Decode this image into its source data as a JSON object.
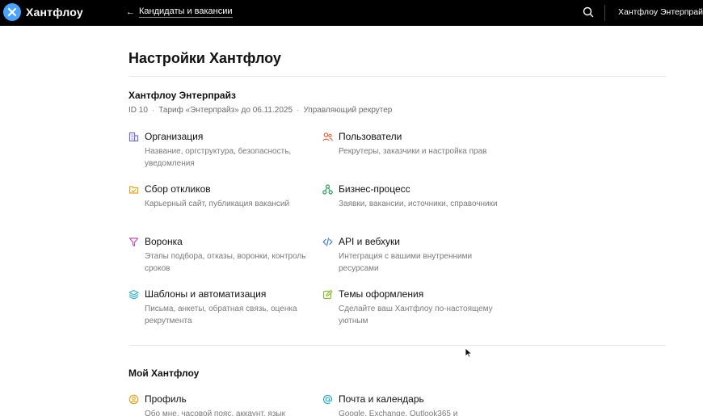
{
  "topbar": {
    "logo_text": "Хантфлоу",
    "back_label": "Кандидаты и вакансии",
    "org_name": "Хантфлоу Энтерпрайз"
  },
  "page": {
    "title": "Настройки Хантфлоу"
  },
  "company": {
    "name": "Хантфлоу Энтерпрайз",
    "id": "ID 10",
    "tariff": "Тариф «Энтерпрайз» до 06.11.2025",
    "role": "Управляющий рекрутер"
  },
  "settings": {
    "items": [
      {
        "title": "Организация",
        "desc": "Название, оргструктура, безопасность, уведомления",
        "icon": "building-icon",
        "color": "#6b6fd6"
      },
      {
        "title": "Пользователи",
        "desc": "Рекрутеры, заказчики и настройка прав",
        "icon": "users-icon",
        "color": "#e0653a"
      },
      {
        "title": "Сбор откликов",
        "desc": "Карьерный сайт, публикация вакансий",
        "icon": "folder-icon",
        "color": "#e6a31a"
      },
      {
        "title": "Бизнес-процесс",
        "desc": "Заявки, вакансии, источники, справочники",
        "icon": "process-icon",
        "color": "#2e9e5b"
      },
      {
        "title": "Воронка",
        "desc": "Этапы подбора, отказы, воронки, контроль сроков",
        "icon": "funnel-icon",
        "color": "#c64fbf"
      },
      {
        "title": "API и вебхуки",
        "desc": "Интеграция с вашими внутренними ресурсами",
        "icon": "code-icon",
        "color": "#3b7dd8"
      },
      {
        "title": "Шаблоны и автоматизация",
        "desc": "Письма, анкеты, обратная связь, оценка рекрутмента",
        "icon": "layers-icon",
        "color": "#2bb0c9"
      },
      {
        "title": "Темы оформления",
        "desc": "Сделайте ваш Хантфлоу по-настоящему уютным",
        "icon": "edit-icon",
        "color": "#8ab82a"
      }
    ]
  },
  "my": {
    "section_title": "Мой Хантфлоу",
    "items": [
      {
        "title": "Профиль",
        "desc": "Обо мне, часовой пояс, аккаунт, язык",
        "icon": "profile-icon",
        "color": "#e6a31a"
      },
      {
        "title": "Почта и календарь",
        "desc": "Google, Exchange, Outlook365 и",
        "icon": "at-icon",
        "color": "#2bb0c9"
      }
    ]
  }
}
